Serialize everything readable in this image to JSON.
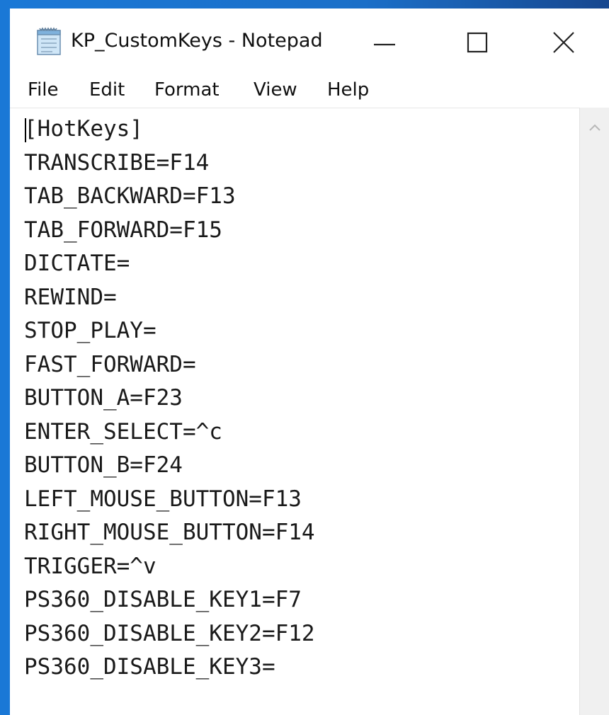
{
  "window": {
    "title": "KP_CustomKeys - Notepad",
    "accent_color": "#1a78d6",
    "icon": "notepad-icon"
  },
  "titlebar": {
    "minimize_icon": "minimize-icon",
    "maximize_icon": "maximize-icon",
    "close_icon": "close-icon"
  },
  "menu": {
    "file": "File",
    "edit": "Edit",
    "format": "Format",
    "view": "View",
    "help": "Help"
  },
  "document": {
    "lines": [
      "[HotKeys]",
      "TRANSCRIBE=F14",
      "TAB_BACKWARD=F13",
      "TAB_FORWARD=F15",
      "DICTATE=",
      "REWIND=",
      "STOP_PLAY=",
      "FAST_FORWARD=",
      "BUTTON_A=F23",
      "ENTER_SELECT=^c",
      "BUTTON_B=F24",
      "LEFT_MOUSE_BUTTON=F13",
      "RIGHT_MOUSE_BUTTON=F14",
      "TRIGGER=^v",
      "PS360_DISABLE_KEY1=F7",
      "PS360_DISABLE_KEY2=F12",
      "PS360_DISABLE_KEY3="
    ]
  },
  "scrollbar": {
    "up_icon": "scroll-up-arrow-icon"
  }
}
